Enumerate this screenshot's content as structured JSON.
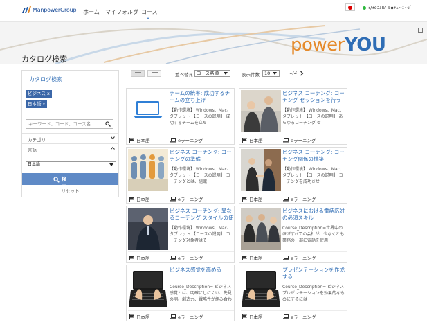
{
  "header": {
    "brand": "ManpowerGroup",
    "nav": [
      "ホーム",
      "マイフォルダ",
      "コース"
    ],
    "user_name": "ﾐ/ｫoﾆｴlﾑ' ﾙ◆ｬﾑ~ｪ~ｼﾞ",
    "status_color": "#2db83d"
  },
  "banner": {
    "title": "カタログ検索",
    "brand_left": "power",
    "brand_right": "YOU"
  },
  "sidebar": {
    "title": "カタログ検索",
    "active_filters": [
      "ビジネス",
      "日本語"
    ],
    "remove_glyph": "x",
    "search_placeholder": "キーワード、コード、コース名",
    "category_label": "カテゴリ",
    "language_label": "言語",
    "language_value": "日本語",
    "search_button": "検索",
    "reset_label": "リセット"
  },
  "toolbar": {
    "sort_label": "並べ替え",
    "sort_value": "コース名順",
    "count_label": "表示件数",
    "count_value": "10",
    "pager": "1/2"
  },
  "courses": [
    {
      "title": "チームの統率: 成功するチームの立ち上げ",
      "desc": "【動作環境】 Windows、Mac、タブレット 【コースの説明】 成功するチームを立ち",
      "lang": "日本語",
      "kind": "eラーニング",
      "thumb": "laptop-icon"
    },
    {
      "title": "ビジネス コーチング: コーチング セッションを行う",
      "desc": "【動作環境】 Windows、Mac、タブレット 【コースの説明】 あらゆるコーチング セ",
      "lang": "日本語",
      "kind": "eラーニング",
      "thumb": "business-meeting-photo"
    },
    {
      "title": "ビジネス コーチング: コーチングの準備",
      "desc": "【動作環境】 Windows、Mac、タブレット 【コースの説明】 コーチングとは、組織",
      "lang": "日本語",
      "kind": "eラーニング",
      "thumb": "people-figures-photo"
    },
    {
      "title": "ビジネス コーチング: コーチング関係の構築",
      "desc": "【動作環境】 Windows、Mac、タブレット 【コースの説明】 コーチングを成功させ",
      "lang": "日本語",
      "kind": "eラーニング",
      "thumb": "handshake-photo"
    },
    {
      "title": "ビジネス コーチング: 異なるコーチング スタイルの使用",
      "desc": "【動作環境】 Windows、Mac、タブレット 【コースの説明】 コーチング対象者はそ",
      "lang": "日本語",
      "kind": "eラーニング",
      "thumb": "speaker-photo"
    },
    {
      "title": "ビジネスにおける電話応対の必須スキル",
      "desc": "Course_Description=世界中のほぼすべての会社が、少なくとも業務の一部に電話を使用",
      "lang": "日本語",
      "kind": "eラーニング",
      "thumb": "office-people-photo"
    },
    {
      "title": "ビジネス感覚を高める",
      "desc": "Course_Description= ビジネス感覚とは、明確にしにくい、先見の明、創造力、戦略性が組み合わさったもの",
      "lang": "日本語",
      "kind": "eラーニング",
      "thumb": "keyboard-hands-photo"
    },
    {
      "title": "プレゼンテーションを作成する",
      "desc": "Course_Description= ビジネス プレゼンテーションを効果的なものにするには",
      "lang": "日本語",
      "kind": "eラーニング",
      "thumb": "keyboard-hands-photo"
    }
  ],
  "colors": {
    "accent": "#2f6db5",
    "button": "#5f8ac6",
    "chip": "#3b67a8",
    "brand_orange": "#e58a2b"
  }
}
